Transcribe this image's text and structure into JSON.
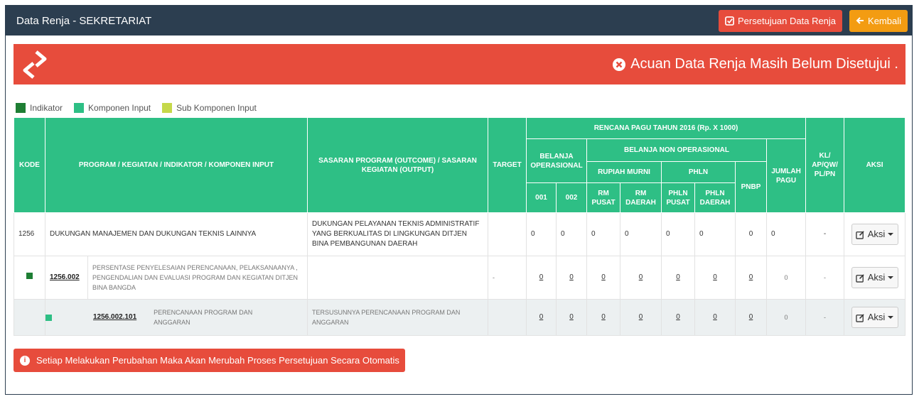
{
  "header": {
    "title": "Data Renja - SEKRETARIAT",
    "approve_label": "Persetujuan Data Renja",
    "back_label": "Kembali"
  },
  "banner": {
    "message": "Acuan Data Renja Masih Belum Disetujui ."
  },
  "legend": [
    {
      "label": "Indikator",
      "color": "#1e7e34"
    },
    {
      "label": "Komponen Input",
      "color": "#2ebf85"
    },
    {
      "label": "Sub Komponen Input",
      "color": "#c5d84a"
    }
  ],
  "table": {
    "headers": {
      "kode": "KODE",
      "program": "PROGRAM / KEGIATAN / INDIKATOR / KOMPONEN INPUT",
      "sasaran": "SASARAN PROGRAM (OUTCOME) / SASARAN KEGIATAN (OUTPUT)",
      "target": "TARGET",
      "rencana": "RENCANA PAGU TAHUN 2016 (Rp. X 1000)",
      "belanja_op": "BELANJA OPERASIONAL",
      "belanja_non": "BELANJA NON OPERASIONAL",
      "rupiah_murni": "RUPIAH MURNI",
      "phln": "PHLN",
      "pnbp": "PNBP",
      "jumlah": "JUMLAH PAGU",
      "kl": "KL/ AP/QW/ PL/PN",
      "aksi": "AKSI",
      "c001": "001",
      "c002": "002",
      "rm_pusat": "RM PUSAT",
      "rm_daerah": "RM DAERAH",
      "phln_pusat": "PHLN PUSAT",
      "phln_daerah": "PHLN DAERAH"
    },
    "rows": [
      {
        "kode": "1256",
        "program": "DUKUNGAN MANAJEMEN DAN DUKUNGAN TEKNIS LAINNYA",
        "sasaran": "DUKUNGAN PELAYANAN TEKNIS ADMINISTRATIF YANG BERKUALITAS DI LINGKUNGAN DITJEN BINA PEMBANGUNAN DAERAH",
        "target": "",
        "values": [
          "0",
          "0",
          "0",
          "0",
          "0",
          "0",
          "0",
          "0"
        ],
        "kl": "-",
        "aksi": "Aksi"
      },
      {
        "kode": "1256.002",
        "program": "PERSENTASE PENYELESAIAN PERENCANAAN, PELAKSANAANYA , PENGENDALIAN DAN EVALUASI PROGRAM DAN KEGIATAN DITJEN BINA BANGDA",
        "sasaran": "",
        "target": "-",
        "values": [
          "0",
          "0",
          "0",
          "0",
          "0",
          "0",
          "0",
          "0"
        ],
        "kl": "-",
        "aksi": "Aksi"
      },
      {
        "kode": "1256.002.101",
        "program": "PERENCANAAN PROGRAM DAN ANGGARAN",
        "sasaran": "TERSUSUNNYA PERENCANAAN PROGRAM DAN ANGGARAN",
        "target": "",
        "values": [
          "0",
          "0",
          "0",
          "0",
          "0",
          "0",
          "0",
          "0"
        ],
        "kl": "-",
        "aksi": "Aksi"
      }
    ]
  },
  "bottom_alert": {
    "message": "Setiap Melakukan Perubahan Maka Akan Merubah Proses Persetujuan Secara Otomatis"
  }
}
